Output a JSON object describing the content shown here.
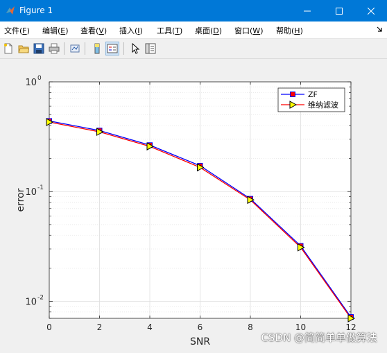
{
  "window": {
    "title": "Figure 1",
    "accent": "#0078d7"
  },
  "menu": [
    {
      "label": "文件(",
      "key": "F",
      "tail": ")"
    },
    {
      "label": "编辑(",
      "key": "E",
      "tail": ")"
    },
    {
      "label": "查看(",
      "key": "V",
      "tail": ")"
    },
    {
      "label": "插入(",
      "key": "I",
      "tail": ")"
    },
    {
      "label": "工具(",
      "key": "T",
      "tail": ")"
    },
    {
      "label": "桌面(",
      "key": "D",
      "tail": ")"
    },
    {
      "label": "窗口(",
      "key": "W",
      "tail": ")"
    },
    {
      "label": "帮助(",
      "key": "H",
      "tail": ")"
    }
  ],
  "toolbar": {
    "icons": [
      "new-figure-icon",
      "open-file-icon",
      "save-icon",
      "print-icon",
      "link-plot-icon",
      "colorbar-icon",
      "legend-icon",
      "pointer-icon",
      "property-inspector-icon"
    ]
  },
  "chart_data": {
    "type": "line",
    "title": "",
    "xlabel": "SNR",
    "ylabel": "error",
    "yscale": "log",
    "xlim": [
      0,
      12
    ],
    "ylim": [
      0.007,
      1
    ],
    "x": [
      0,
      2,
      4,
      6,
      8,
      10,
      12
    ],
    "xticks": [
      "0",
      "2",
      "4",
      "6",
      "8",
      "10",
      "12"
    ],
    "yticks": [
      {
        "base": "10",
        "exp": "0",
        "value": 1
      },
      {
        "base": "10",
        "exp": "-1",
        "value": 0.1
      },
      {
        "base": "10",
        "exp": "-2",
        "value": 0.01
      }
    ],
    "grid": true,
    "legend_position": "top-right",
    "series": [
      {
        "name": "ZF",
        "color": "#0000ff",
        "marker": "square",
        "marker_fill": "#ff0000",
        "values": [
          0.44,
          0.36,
          0.265,
          0.172,
          0.086,
          0.032,
          0.0072
        ]
      },
      {
        "name": "维纳滤波",
        "color": "#ff0000",
        "marker": "triangle-right",
        "marker_fill": "#ffff00",
        "values": [
          0.43,
          0.35,
          0.258,
          0.166,
          0.084,
          0.031,
          0.007
        ]
      }
    ]
  },
  "watermark": "CSDN @简简单单做算法"
}
